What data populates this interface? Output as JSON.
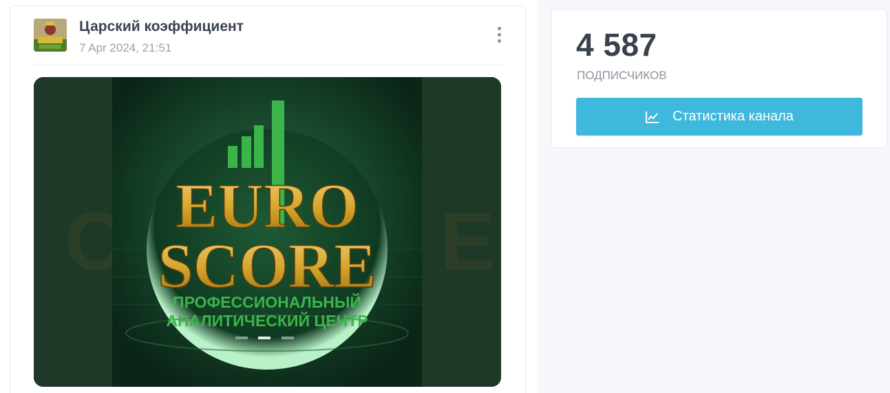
{
  "post": {
    "channel_name": "Царский коэффициент",
    "date": "7 Apr 2024, 21:51",
    "menu_icon": "more-vertical-icon",
    "image": {
      "brand_line1": "EURO",
      "brand_line2": "SCORE",
      "tagline_line1": "ПРОФЕССИОНАЛЬНЫЙ",
      "tagline_line2": "АНАЛИТИЧЕСКИЙ ЦЕНТР"
    }
  },
  "stats": {
    "subscribers_count": "4 587",
    "subscribers_label": "ПОДПИСЧИКОВ",
    "button_label": "Статистика канала",
    "button_icon": "line-chart-icon"
  },
  "colors": {
    "accent_button": "#3fb8dd",
    "brand_gold": "#d4a32a",
    "brand_green": "#3bb54a"
  }
}
